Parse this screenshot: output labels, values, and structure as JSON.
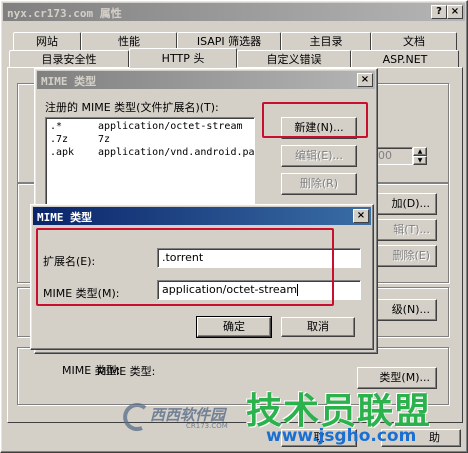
{
  "props": {
    "title": "nyx.cr173.com 属性",
    "help_btn": "?",
    "close_btn": "×",
    "tabs_row1": [
      "网站",
      "性能",
      "ISAPI 筛选器",
      "主目录",
      "文档"
    ],
    "tabs_row2": [
      "目录安全性",
      "HTTP 头",
      "自定义错误",
      "ASP.NET"
    ],
    "bg_buttons": [
      "加(D)...",
      "辑(T)...",
      "删除(E)",
      "级(N)...",
      "类型(M)...",
      "助"
    ],
    "bg_ok": "取",
    "spin_value": "00"
  },
  "mime_list_dialog": {
    "title": "MIME 类型",
    "close_btn": "×",
    "list_label": "注册的 MIME 类型(文件扩展名)(T):",
    "items": [
      {
        "ext": ".*",
        "type": "application/octet-stream"
      },
      {
        "ext": ".7z",
        "type": "7z"
      },
      {
        "ext": ".apk",
        "type": "application/vnd.android.packa"
      }
    ],
    "new_btn": "新建(N)...",
    "edit_btn": "编辑(E)...",
    "delete_btn": "删除(R)",
    "mime_type_label": "MIME 类型:"
  },
  "mime_edit_dialog": {
    "title": "MIME 类型",
    "close_btn": "×",
    "ext_label": "扩展名(E):",
    "ext_value": ".torrent",
    "mime_label": "MIME 类型(M):",
    "mime_value": "application/octet-stream",
    "ok_btn": "确定",
    "cancel_btn": "取消"
  },
  "watermark": {
    "logo_left": "西西软件园",
    "logo_left_sub": "CR173.COM",
    "logo_right": "技术员联盟",
    "url": "www.jsgho.com"
  },
  "colors": {
    "accent_red": "#c8102e",
    "title_active": "#0a246a",
    "watermark_green": "#2bb24c"
  }
}
